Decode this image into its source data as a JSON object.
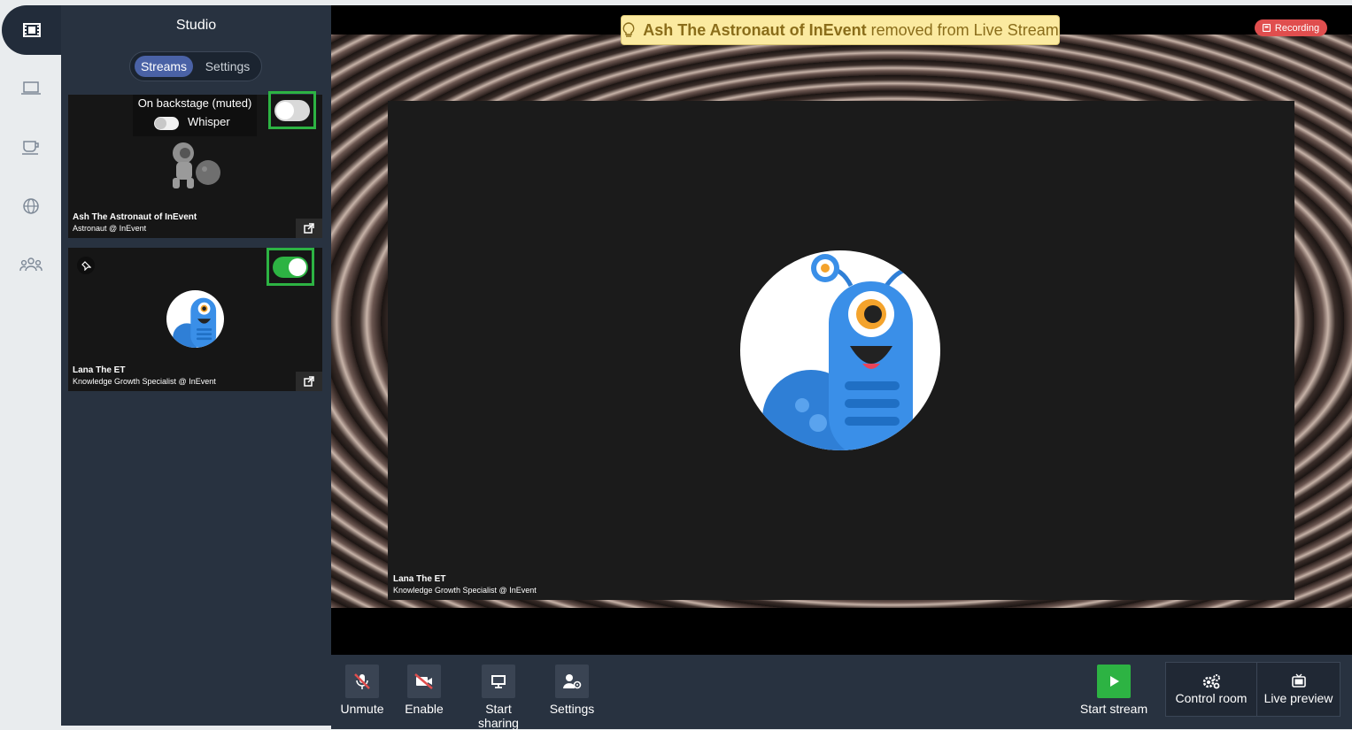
{
  "sidebar": {
    "title": "Studio",
    "tabs": [
      {
        "label": "Streams",
        "active": true
      },
      {
        "label": "Settings",
        "active": false
      }
    ]
  },
  "rail": {
    "items": [
      "film-icon",
      "laptop-icon",
      "coffee-cup-icon",
      "globe-icon",
      "users-icon"
    ]
  },
  "cards": [
    {
      "status_label": "On backstage (muted)",
      "whisper_label": "Whisper",
      "whisper_on": false,
      "toggle_on": false,
      "name": "Ash The Astronaut of InEvent",
      "role": "Astronaut @ InEvent"
    },
    {
      "toggle_on": true,
      "name": "Lana The ET",
      "role": "Knowledge Growth Specialist @ InEvent"
    }
  ],
  "stage": {
    "notice_name": "Ash The Astronaut of InEvent",
    "notice_rest": "removed from Live Stream",
    "recording_label": "Recording",
    "feed_name": "Lana The ET",
    "feed_role": "Knowledge Growth Specialist @ InEvent"
  },
  "toolbar": {
    "unmute": "Unmute",
    "enable": "Enable",
    "start_sharing": "Start sharing",
    "settings": "Settings",
    "start_stream": "Start stream",
    "control_room": "Control room",
    "live_preview": "Live preview"
  },
  "colors": {
    "sidebar": "#283240",
    "accent": "#4a62a6",
    "toggle_on": "#2db343",
    "notice_bg": "#fbeaa0",
    "recording": "#e04e4e",
    "start_stream": "#2db343"
  }
}
